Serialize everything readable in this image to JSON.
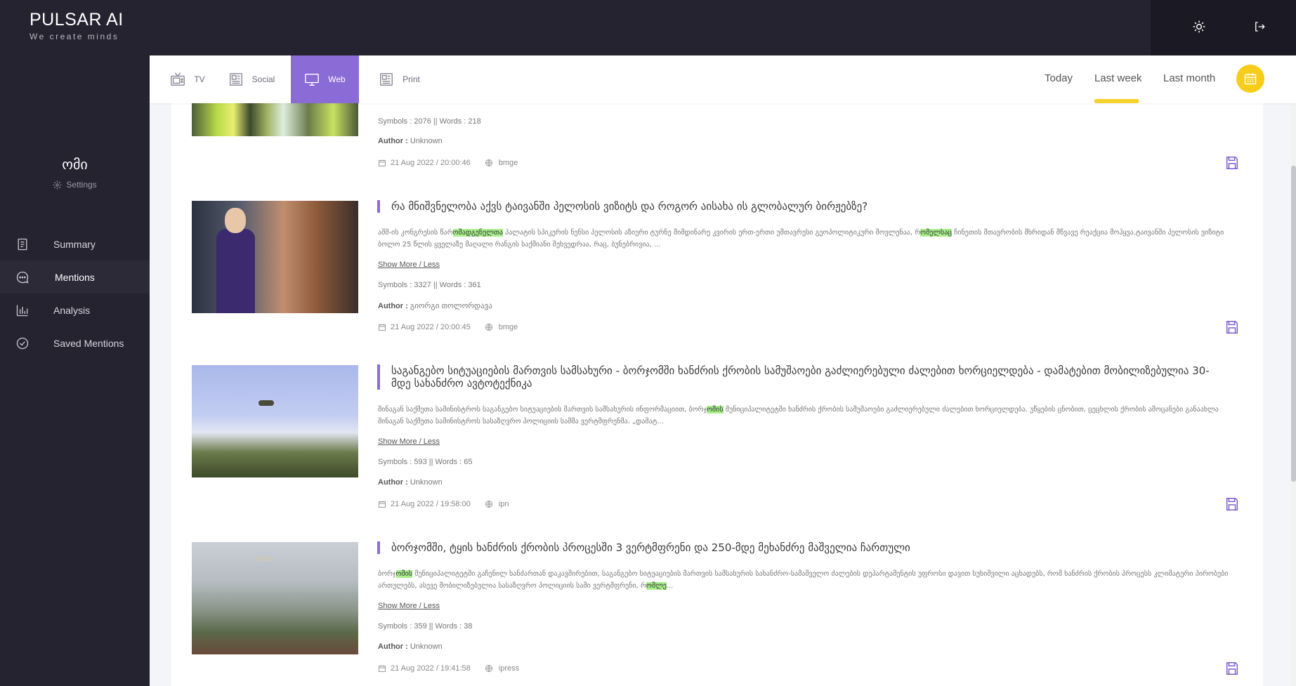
{
  "brand": {
    "name": "PULSAR AI",
    "tagline": "We create minds"
  },
  "user": {
    "name": "ომი",
    "settings_label": "Settings"
  },
  "nav": {
    "items": [
      {
        "label": "Summary"
      },
      {
        "label": "Mentions"
      },
      {
        "label": "Analysis"
      },
      {
        "label": "Saved Mentions"
      }
    ]
  },
  "sources": {
    "tabs": [
      {
        "label": "TV"
      },
      {
        "label": "Social"
      },
      {
        "label": "Web"
      },
      {
        "label": "Print"
      }
    ],
    "active": "Web"
  },
  "periods": {
    "tabs": [
      {
        "label": "Today"
      },
      {
        "label": "Last week"
      },
      {
        "label": "Last month"
      }
    ],
    "active": "Last week"
  },
  "colors": {
    "accent": "#8b6bd6",
    "highlight": "#a8f08c",
    "underline": "#f7d22f",
    "sidebar": "#25232f"
  },
  "common": {
    "show_more": "Show More / Less",
    "author_label": "Author :"
  },
  "mentions": [
    {
      "stats": "Symbols : 2076 || Words : 218",
      "author": "Unknown",
      "date": "21 Aug 2022 / 20:00:46",
      "source": "bmge"
    },
    {
      "title": "რა მნიშვნელობა აქვს ტაივანში პელოსის ვიზიტს და როგორ აისახა ის გლობალურ ბირჟებზე?",
      "snippet_parts": [
        "აშშ-ის კონგრესის წარ",
        "ომადგენელთა",
        " პალატის სპიკერის ნენსი პელოსის აზიური ტურნე მიმდინარე კვირის ერთ-ერთი უმთავრესი გეოპოლიტიკური მოვლენაა, რ",
        "ომელსაც",
        " ჩინეთის მთავრობის მხრიდან მწვავე რეაქცია მოჰყვა.ტაივანში პელოსის ვიზიტი ბოლო 25 წლის ყველაზე მაღალი რანგის საქმიანი შეხვედრაა, რაც, ბუნებრივია, ..."
      ],
      "stats": "Symbols : 3327 || Words : 361",
      "author": "გიორგი თოლორდავა",
      "date": "21 Aug 2022 / 20:00:45",
      "source": "bmge"
    },
    {
      "title": "საგანგებო სიტუაციების მართვის სამსახური - ბორჯომში ხანძრის ქრობის სამუშაოები გაძლიერებული ძალებით ხორციელდება - დამატებით მობილიზებულია 30-მდე სახანძრო ავტოტექნიკა",
      "snippet_parts": [
        "შინაგან საქმეთა სამინისტროს საგანგებო სიტუაციების მართვის სამსახურის ინფორმაციით, ბორჯ",
        "ომის",
        " მუნიციპალიტეტში ხანძრის ქრობის სამუშაოები გაძლიერებული ძალებით ხორციელდება. უწყების ცნობით, ცეცხლის ქრობის ამოცანები განაახლა შინაგან საქმეთა სამინისტროს სასაზღვრო პოლიციის სამმა ვერტმფრენმა. „დამატ..."
      ],
      "stats": "Symbols : 593 || Words : 65",
      "author": "Unknown",
      "date": "21 Aug 2022 / 19:58:00",
      "source": "ipn"
    },
    {
      "title": "ბორჯომში, ტყის ხანძრის ქრობის პროცესში 3 ვერტმფრენი და 250-მდე მეხანძრე მაშველია ჩართული",
      "snippet_parts": [
        "ბორჯ",
        "ომის",
        " მუნიციპალიტეტში გაჩენილ ხანძართან დაკავშირებით, საგანგებო სიტუაციების მართვის სამსახურის სახანძრო-სამაშველო ძალების დეპარტამენტის უფროსი დავით სუხიშვილი აცხადებს, რომ ხანძრის ქრობის პროცესს კლიმატური პირობები ართულებს, ასევე მობილიზებულია სასაზღვრო პოლიციის სამი ვერტმფრენი, რ",
        "ომლე",
        "..."
      ],
      "stats": "Symbols : 359 || Words : 38",
      "author": "Unknown",
      "date": "21 Aug 2022 / 19:41:58",
      "source": "ipress"
    }
  ]
}
